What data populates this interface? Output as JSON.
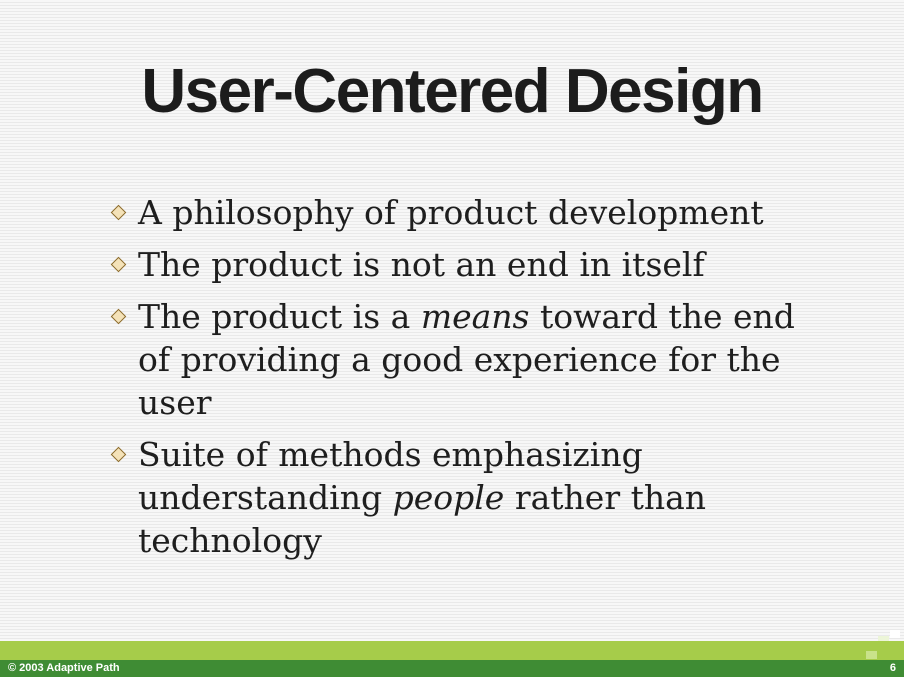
{
  "slide": {
    "title": "User-Centered Design",
    "bullets": [
      {
        "segments": [
          {
            "text": "A philosophy of product development",
            "italic": false
          }
        ]
      },
      {
        "segments": [
          {
            "text": "The product is not an end in itself",
            "italic": false
          }
        ]
      },
      {
        "segments": [
          {
            "text": "The product is a ",
            "italic": false
          },
          {
            "text": "means",
            "italic": true
          },
          {
            "text": " toward the end of providing a good experience for the user",
            "italic": false
          }
        ]
      },
      {
        "segments": [
          {
            "text": "Suite of methods emphasizing understanding ",
            "italic": false
          },
          {
            "text": "people",
            "italic": true
          },
          {
            "text": " rather than technology",
            "italic": false
          }
        ]
      }
    ]
  },
  "footer": {
    "copyright": "© 2003 Adaptive Path",
    "page_number": "6"
  },
  "colors": {
    "footer_light_green": "#a6cc4a",
    "footer_dark_green": "#3f8c34",
    "bullet_fill": "#f4e2b8",
    "bullet_border": "#8a6a2c"
  },
  "icons": {
    "bullet": "diamond-bullet-icon"
  }
}
